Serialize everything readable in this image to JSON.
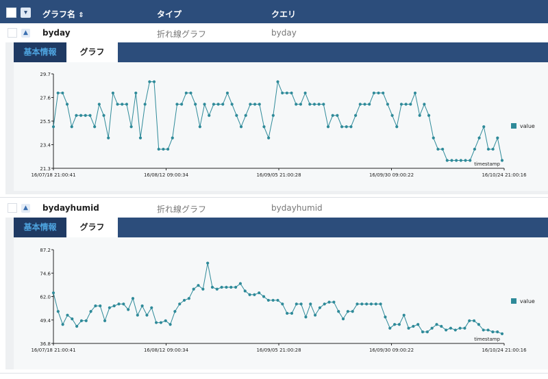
{
  "header": {
    "col_name": "グラフ名",
    "col_type": "タイプ",
    "col_query": "クエリ",
    "sort_icon": "sort-icon"
  },
  "graphs": [
    {
      "name": "byday",
      "type": "折れ線グラフ",
      "query": "byday",
      "tabs": [
        "基本情報",
        "グラフ"
      ],
      "chart_data": {
        "type": "line",
        "xlabel": "timestamp",
        "x_ticks": [
          "16/07/18 21:00:41",
          "16/08/12 09:00:34",
          "16/09/05 21:00:28",
          "16/09/30 09:00:22",
          "16/10/24 21:00:16"
        ],
        "y_ticks": [
          "21.3",
          "23.4",
          "25.5",
          "27.6",
          "29.7"
        ],
        "ylim": [
          21.3,
          29.7
        ],
        "series": [
          {
            "name": "value",
            "color": "#2e8a99",
            "values": [
              25,
              28,
              28,
              27,
              25,
              26,
              26,
              26,
              26,
              25,
              27,
              26,
              24,
              28,
              27,
              27,
              27,
              25,
              28,
              24,
              27,
              29,
              29,
              23,
              23,
              23,
              24,
              27,
              27,
              28,
              28,
              27,
              25,
              27,
              26,
              27,
              27,
              27,
              28,
              27,
              26,
              25,
              26,
              27,
              27,
              27,
              25,
              24,
              26,
              29,
              28,
              28,
              28,
              27,
              27,
              28,
              27,
              27,
              27,
              27,
              25,
              26,
              26,
              25,
              25,
              25,
              26,
              27,
              27,
              27,
              28,
              28,
              28,
              27,
              26,
              25,
              27,
              27,
              27,
              28,
              26,
              27,
              26,
              24,
              23,
              23,
              22,
              22,
              22,
              22,
              22,
              22,
              23,
              24,
              25,
              23,
              23,
              24,
              22
            ]
          }
        ]
      }
    },
    {
      "name": "bydayhumid",
      "type": "折れ線グラフ",
      "query": "bydayhumid",
      "tabs": [
        "基本情報",
        "グラフ"
      ],
      "chart_data": {
        "type": "line",
        "xlabel": "timestamp",
        "x_ticks": [
          "16/07/18 21:00:41",
          "16/08/12 09:00:34",
          "16/09/05 21:00:28",
          "16/09/30 09:00:22",
          "16/10/24 21:00:16"
        ],
        "y_ticks": [
          "36.8",
          "49.4",
          "62.0",
          "74.6",
          "87.2"
        ],
        "ylim": [
          36.8,
          87.2
        ],
        "series": [
          {
            "name": "value",
            "color": "#2e8a99",
            "values": [
              64,
              54,
              47,
              52,
              50,
              46,
              49,
              49,
              54,
              57,
              57,
              49,
              56,
              57,
              58,
              58,
              55,
              61,
              52,
              57,
              52,
              56,
              48,
              48,
              49,
              47,
              54,
              58,
              60,
              61,
              66,
              68,
              66,
              80,
              67,
              66,
              67,
              67,
              67,
              67,
              69,
              65,
              63,
              63,
              64,
              62,
              60,
              60,
              60,
              58,
              53,
              53,
              58,
              58,
              51,
              58,
              52,
              56,
              58,
              59,
              59,
              54,
              50,
              54,
              54,
              58,
              58,
              58,
              58,
              58,
              58,
              51,
              45,
              47,
              47,
              52,
              45,
              46,
              47,
              43,
              43,
              45,
              47,
              46,
              44,
              45,
              44,
              45,
              45,
              49,
              49,
              47,
              44,
              44,
              43,
              43,
              42
            ]
          }
        ]
      }
    }
  ]
}
